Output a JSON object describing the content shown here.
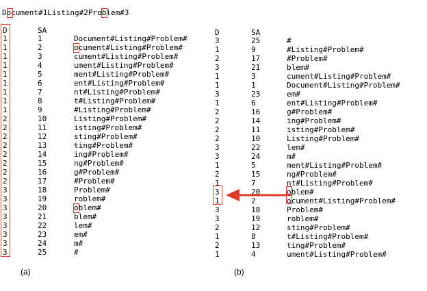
{
  "title": "Document#1Listing#2Problem#3",
  "table_a": {
    "headers": {
      "d": "D",
      "sa": "SA",
      "suffix": ""
    },
    "caption": "(a)",
    "rows": [
      {
        "d": "1",
        "sa": "1",
        "suffix": "Document#Listing#Problem#"
      },
      {
        "d": "1",
        "sa": "2",
        "suffix": "ocument#Listing#Problem#"
      },
      {
        "d": "1",
        "sa": "3",
        "suffix": "cument#Listing#Problem#"
      },
      {
        "d": "1",
        "sa": "4",
        "suffix": "ument#Listing#Problem#"
      },
      {
        "d": "1",
        "sa": "5",
        "suffix": "ment#Listing#Problem#"
      },
      {
        "d": "1",
        "sa": "6",
        "suffix": "ent#Listing#Problem#"
      },
      {
        "d": "1",
        "sa": "7",
        "suffix": "nt#Listing#Problem#"
      },
      {
        "d": "1",
        "sa": "8",
        "suffix": "t#Listing#Problem#"
      },
      {
        "d": "1",
        "sa": "9",
        "suffix": "#Listing#Problem#"
      },
      {
        "d": "2",
        "sa": "10",
        "suffix": "Listing#Problem#"
      },
      {
        "d": "2",
        "sa": "11",
        "suffix": "isting#Problem#"
      },
      {
        "d": "2",
        "sa": "12",
        "suffix": "sting#Problem#"
      },
      {
        "d": "2",
        "sa": "13",
        "suffix": "ting#Problem#"
      },
      {
        "d": "2",
        "sa": "14",
        "suffix": "ing#Problem#"
      },
      {
        "d": "2",
        "sa": "15",
        "suffix": "ng#Problem#"
      },
      {
        "d": "2",
        "sa": "16",
        "suffix": "g#Problem#"
      },
      {
        "d": "2",
        "sa": "17",
        "suffix": "#Problem#"
      },
      {
        "d": "3",
        "sa": "18",
        "suffix": "Problem#"
      },
      {
        "d": "3",
        "sa": "19",
        "suffix": "roblem#"
      },
      {
        "d": "3",
        "sa": "20",
        "suffix": "oblem#"
      },
      {
        "d": "3",
        "sa": "21",
        "suffix": "blem#"
      },
      {
        "d": "3",
        "sa": "22",
        "suffix": "lem#"
      },
      {
        "d": "3",
        "sa": "23",
        "suffix": "em#"
      },
      {
        "d": "3",
        "sa": "24",
        "suffix": "m#"
      },
      {
        "d": "3",
        "sa": "25",
        "suffix": "#"
      }
    ]
  },
  "table_b": {
    "headers": {
      "d": "D",
      "sa": "SA",
      "suffix": ""
    },
    "caption": "(b)",
    "rows": [
      {
        "d": "3",
        "sa": "25",
        "suffix": "#"
      },
      {
        "d": "1",
        "sa": "9",
        "suffix": "#Listing#Problem#"
      },
      {
        "d": "2",
        "sa": "17",
        "suffix": "#Problem#"
      },
      {
        "d": "3",
        "sa": "21",
        "suffix": "blem#"
      },
      {
        "d": "1",
        "sa": "3",
        "suffix": "cument#Listing#Problem#"
      },
      {
        "d": "1",
        "sa": "1",
        "suffix": "Document#Listing#Problem#"
      },
      {
        "d": "3",
        "sa": "23",
        "suffix": "em#"
      },
      {
        "d": "1",
        "sa": "6",
        "suffix": "ent#Listing#Problem#"
      },
      {
        "d": "2",
        "sa": "16",
        "suffix": "g#Problem#"
      },
      {
        "d": "2",
        "sa": "14",
        "suffix": "ing#Problem#"
      },
      {
        "d": "2",
        "sa": "11",
        "suffix": "isting#Problem#"
      },
      {
        "d": "2",
        "sa": "10",
        "suffix": "Listing#Problem#"
      },
      {
        "d": "3",
        "sa": "22",
        "suffix": "lem#"
      },
      {
        "d": "3",
        "sa": "24",
        "suffix": "m#"
      },
      {
        "d": "1",
        "sa": "5",
        "suffix": "ment#Listing#Problem#"
      },
      {
        "d": "2",
        "sa": "15",
        "suffix": "ng#Problem#"
      },
      {
        "d": "1",
        "sa": "7",
        "suffix": "nt#Listing#Problem#"
      },
      {
        "d": "3",
        "sa": "20",
        "suffix": "oblem#"
      },
      {
        "d": "1",
        "sa": "2",
        "suffix": "ocument#Listing#Problem#"
      },
      {
        "d": "3",
        "sa": "18",
        "suffix": "Problem#"
      },
      {
        "d": "3",
        "sa": "19",
        "suffix": "roblem#"
      },
      {
        "d": "2",
        "sa": "12",
        "suffix": "sting#Problem#"
      },
      {
        "d": "1",
        "sa": "8",
        "suffix": "t#Listing#Problem#"
      },
      {
        "d": "2",
        "sa": "13",
        "suffix": "ting#Problem#"
      },
      {
        "d": "1",
        "sa": "4",
        "suffix": "ument#Listing#Problem#"
      }
    ]
  },
  "colors": {
    "highlight": "#e03a2a",
    "text": "#000000"
  }
}
